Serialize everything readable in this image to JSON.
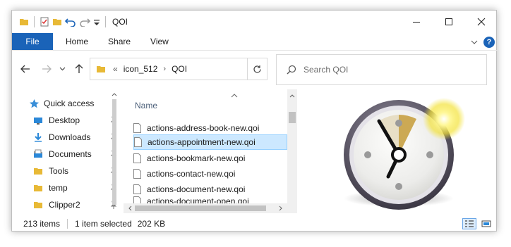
{
  "window": {
    "title": "QOI"
  },
  "ribbon": {
    "tabs": [
      "File",
      "Home",
      "Share",
      "View"
    ]
  },
  "address": {
    "overflow": "«",
    "segments": [
      "icon_512",
      "QOI"
    ]
  },
  "search": {
    "placeholder": "Search QOI"
  },
  "nav_pane": {
    "items": [
      {
        "label": "Quick access",
        "icon": "star-icon"
      },
      {
        "label": "Desktop",
        "icon": "desktop-icon"
      },
      {
        "label": "Downloads",
        "icon": "download-icon"
      },
      {
        "label": "Documents",
        "icon": "documents-icon"
      },
      {
        "label": "Tools",
        "icon": "folder-icon"
      },
      {
        "label": "temp",
        "icon": "folder-icon"
      },
      {
        "label": "Clipper2",
        "icon": "folder-icon"
      }
    ]
  },
  "file_list": {
    "column_header": "Name",
    "files": [
      {
        "name": "actions-address-book-new.qoi",
        "selected": false
      },
      {
        "name": "actions-appointment-new.qoi",
        "selected": true
      },
      {
        "name": "actions-bookmark-new.qoi",
        "selected": false
      },
      {
        "name": "actions-contact-new.qoi",
        "selected": false
      },
      {
        "name": "actions-document-new.qoi",
        "selected": false
      },
      {
        "name": "actions-document-open.qoi",
        "selected": false
      }
    ]
  },
  "preview": {
    "icon": "clock-appointment-icon"
  },
  "status": {
    "item_count": "213 items",
    "selection": "1 item selected",
    "size": "202 KB"
  },
  "colors": {
    "accent": "#1a63b8",
    "selection": "#cce8ff",
    "folder": "#e8b936"
  }
}
